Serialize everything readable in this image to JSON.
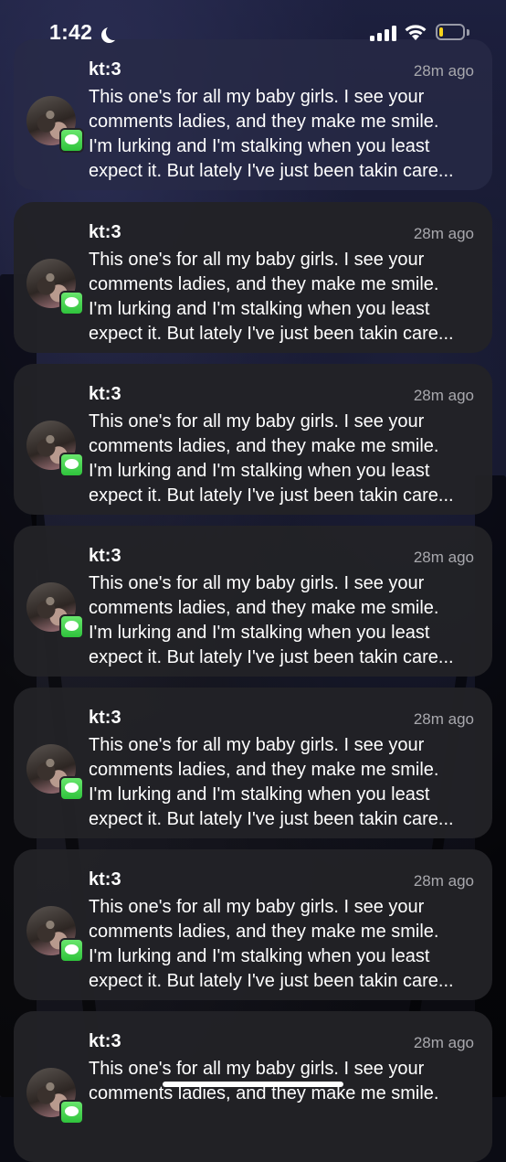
{
  "status_bar": {
    "time": "1:42",
    "focus_icon": "moon-icon",
    "signal_icon": "cellular-signal-icon",
    "wifi_icon": "wifi-icon",
    "battery_icon": "battery-icon",
    "battery_level": 0.18,
    "battery_color": "#f7d31a"
  },
  "notifications": [
    {
      "app_icon": "messages-icon",
      "sender": "kt:3",
      "time": "28m ago",
      "lines": [
        "This one's for all my baby girls. I see your",
        "comments ladies, and they make me smile.",
        "I'm lurking and I'm stalking when you least",
        "expect it. But lately I've just been takin care..."
      ]
    },
    {
      "app_icon": "messages-icon",
      "sender": "kt:3",
      "time": "28m ago",
      "lines": [
        "This one's for all my baby girls. I see your",
        "comments ladies, and they make me smile.",
        "I'm lurking and I'm stalking when you least",
        "expect it. But lately I've just been takin care..."
      ]
    },
    {
      "app_icon": "messages-icon",
      "sender": "kt:3",
      "time": "28m ago",
      "lines": [
        "This one's for all my baby girls. I see your",
        "comments ladies, and they make me smile.",
        "I'm lurking and I'm stalking when you least",
        "expect it. But lately I've just been takin care..."
      ]
    },
    {
      "app_icon": "messages-icon",
      "sender": "kt:3",
      "time": "28m ago",
      "lines": [
        "This one's for all my baby girls. I see your",
        "comments ladies, and they make me smile.",
        "I'm lurking and I'm stalking when you least",
        "expect it. But lately I've just been takin care..."
      ]
    },
    {
      "app_icon": "messages-icon",
      "sender": "kt:3",
      "time": "28m ago",
      "lines": [
        "This one's for all my baby girls. I see your",
        "comments ladies, and they make me smile.",
        "I'm lurking and I'm stalking when you least",
        "expect it. But lately I've just been takin care..."
      ]
    },
    {
      "app_icon": "messages-icon",
      "sender": "kt:3",
      "time": "28m ago",
      "lines": [
        "This one's for all my baby girls. I see your",
        "comments ladies, and they make me smile.",
        "I'm lurking and I'm stalking when you least",
        "expect it. But lately I've just been takin care..."
      ]
    },
    {
      "app_icon": "messages-icon",
      "sender": "kt:3",
      "time": "28m ago",
      "lines": [
        "This one's for all my baby girls. I see your",
        "comments ladies, and they make me smile."
      ]
    }
  ]
}
